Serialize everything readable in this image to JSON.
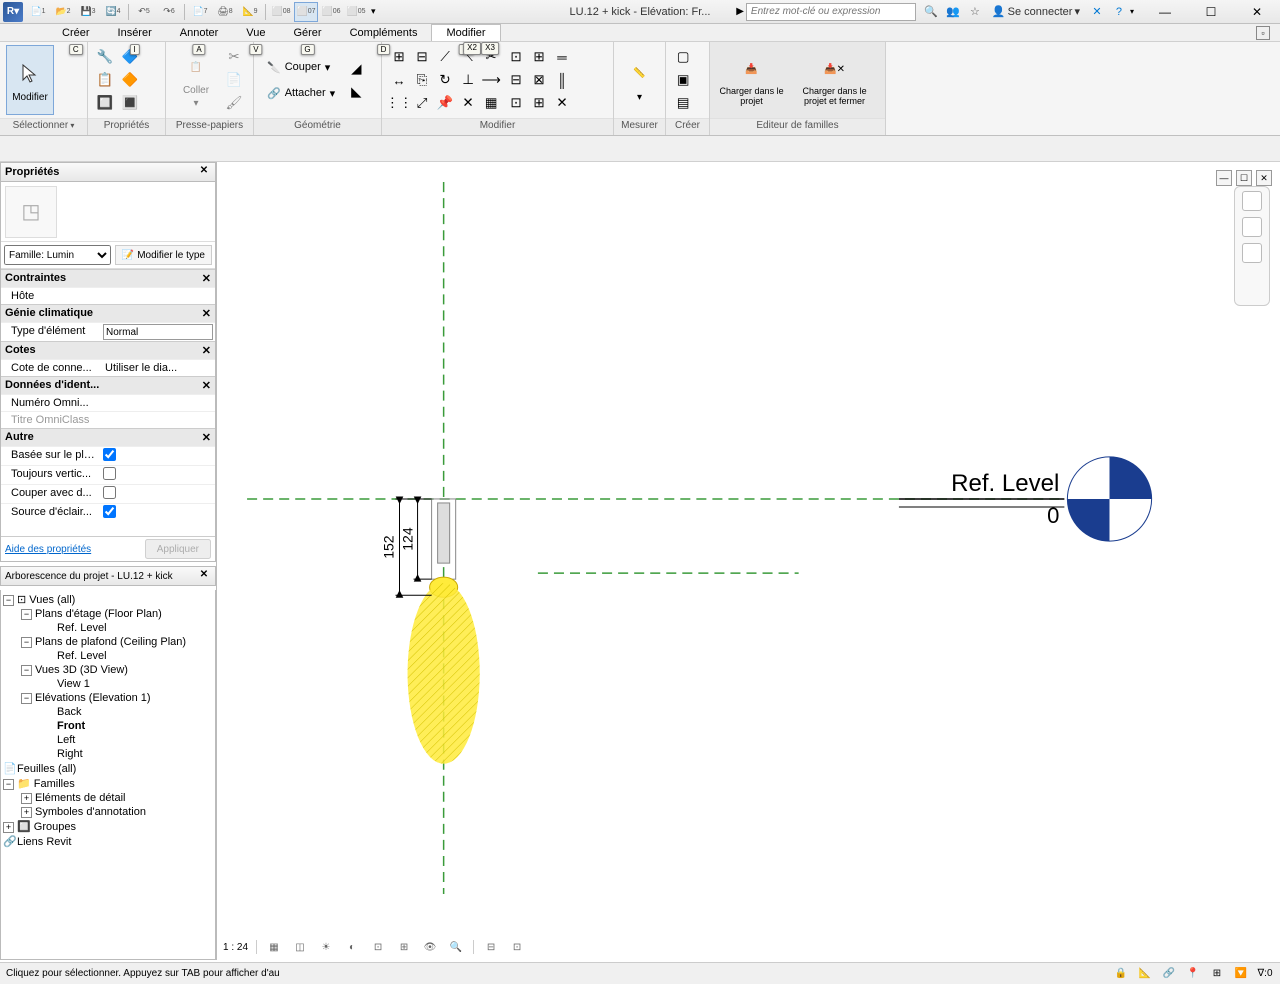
{
  "app": {
    "icon": "R",
    "title": "LU.12 + kick - Elévation: Fr..."
  },
  "qat": {
    "items": [
      "1",
      "2",
      "3",
      "4",
      "5",
      "6",
      "7",
      "8",
      "9",
      "08",
      "07",
      "06",
      "05"
    ]
  },
  "search": {
    "placeholder": "Entrez mot-clé ou expression"
  },
  "signin": {
    "label": "Se connecter"
  },
  "menu": {
    "items": [
      {
        "label": "Créer",
        "key": "C"
      },
      {
        "label": "Insérer",
        "key": "I"
      },
      {
        "label": "Annoter",
        "key": "A"
      },
      {
        "label": "Vue",
        "key": "V"
      },
      {
        "label": "Gérer",
        "key": "G"
      },
      {
        "label": "Compléments",
        "key": "D"
      },
      {
        "label": "Modifier",
        "key": "M",
        "active": true
      }
    ]
  },
  "keytips": [
    "X2",
    "X3"
  ],
  "ribbon": {
    "select": {
      "label": "Modifier",
      "title": "Sélectionner"
    },
    "props": {
      "title": "Propriétés"
    },
    "clip": {
      "paste": "Coller",
      "title": "Presse-papiers"
    },
    "geom": {
      "cut": "Couper",
      "attach": "Attacher",
      "title": "Géométrie"
    },
    "modify": {
      "title": "Modifier"
    },
    "measure": {
      "title": "Mesurer"
    },
    "create": {
      "title": "Créer"
    },
    "editor": {
      "load": "Charger dans le projet",
      "loadclose": "Charger dans le projet et fermer",
      "title": "Editeur de familles"
    }
  },
  "props_panel": {
    "title": "Propriétés",
    "selector": "Famille: Lumin",
    "edit_type": "Modifier le type",
    "cats": {
      "contraintes": "Contraintes",
      "hote": "Hôte",
      "genie": "Génie climatique",
      "type_elem": "Type d'élément",
      "type_elem_val": "Normal",
      "cotes": "Cotes",
      "cote_conn": "Cote de conne...",
      "cote_conn_val": "Utiliser le dia...",
      "ident": "Données d'ident...",
      "omni_num": "Numéro Omni...",
      "omni_title": "Titre OmniClass",
      "autre": "Autre",
      "plan": "Basée sur le pla...",
      "vert": "Toujours vertic...",
      "cut": "Couper avec d...",
      "src": "Source d'éclair..."
    },
    "help": "Aide des propriétés",
    "apply": "Appliquer"
  },
  "browser": {
    "title": "Arborescence du projet - LU.12 + kick",
    "tree": {
      "views": "Vues (all)",
      "floor": "Plans d'étage (Floor Plan)",
      "reflevel": "Ref. Level",
      "ceil": "Plans de plafond (Ceiling Plan)",
      "v3d": "Vues 3D (3D View)",
      "view1": "View 1",
      "elev": "Elévations (Elevation 1)",
      "back": "Back",
      "front": "Front",
      "left": "Left",
      "right": "Right",
      "sheets": "Feuilles (all)",
      "families": "Familles",
      "detail": "Eléments de détail",
      "annot": "Symboles d'annotation",
      "groups": "Groupes",
      "links": "Liens Revit"
    }
  },
  "canvas": {
    "reflevel": "Ref. Level",
    "reflevel_val": "0",
    "dim1": "124",
    "dim2": "152",
    "scale": "1 : 24"
  },
  "status": {
    "hint": "Cliquez pour sélectionner. Appuyez sur TAB pour afficher d'au"
  }
}
